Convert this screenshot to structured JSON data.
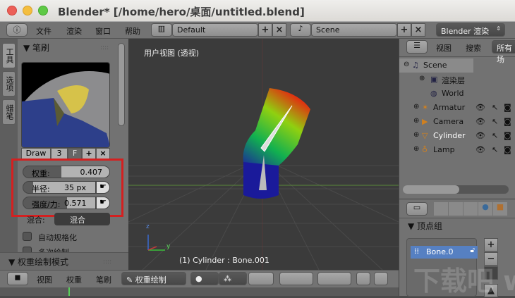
{
  "window": {
    "title": "Blender* [/home/hero/桌面/untitled.blend]"
  },
  "topbar": {
    "menus": [
      "文件",
      "渲染",
      "窗口",
      "帮助"
    ],
    "layout": "Default",
    "scene": "Scene",
    "engine": "Blender 渲染"
  },
  "tool_panel": {
    "tabs": [
      "工具",
      "选项",
      "蜡笔"
    ],
    "brush_header": "笔刷",
    "brush_name": "Draw",
    "brush_users": "3",
    "brush_fake": "F",
    "weight_label": "权重:",
    "weight_value": "0.407",
    "weight_fraction": 0.407,
    "radius_label": "半径:",
    "radius_value": "35 px",
    "strength_label": "强度/力:",
    "strength_value": "0.571",
    "strength_fraction": 0.571,
    "blend_label": "混合:",
    "blend_value": "混合",
    "auto_normalize": "自动规格化",
    "multi_paint": "多次绘制",
    "mode_header": "权重绘制模式"
  },
  "viewport": {
    "label": "用户视图 (透视)",
    "status": "(1) Cylinder : Bone.001",
    "axis_z": "z",
    "axis_y": "y"
  },
  "outliner": {
    "menus": [
      "视图",
      "搜索"
    ],
    "filter": "所有场",
    "items": [
      {
        "name": "Scene",
        "icon": "scene-icon"
      },
      {
        "name": "渲染层",
        "icon": "render-layers-icon"
      },
      {
        "name": "World",
        "icon": "world-icon"
      },
      {
        "name": "Armatur",
        "icon": "armature-icon"
      },
      {
        "name": "Camera",
        "icon": "camera-icon"
      },
      {
        "name": "Cylinder",
        "icon": "mesh-icon"
      },
      {
        "name": "Lamp",
        "icon": "lamp-icon"
      }
    ]
  },
  "properties": {
    "section": "顶点组",
    "vertex_group": "Bone.0"
  },
  "bottombar": {
    "menus": [
      "视图",
      "权重",
      "笔刷"
    ],
    "mode": "权重绘制"
  },
  "watermark": "下载吧 www.xiazaiba.com",
  "colors": {
    "highlight": "#d42020",
    "selection": "#5680c2"
  }
}
